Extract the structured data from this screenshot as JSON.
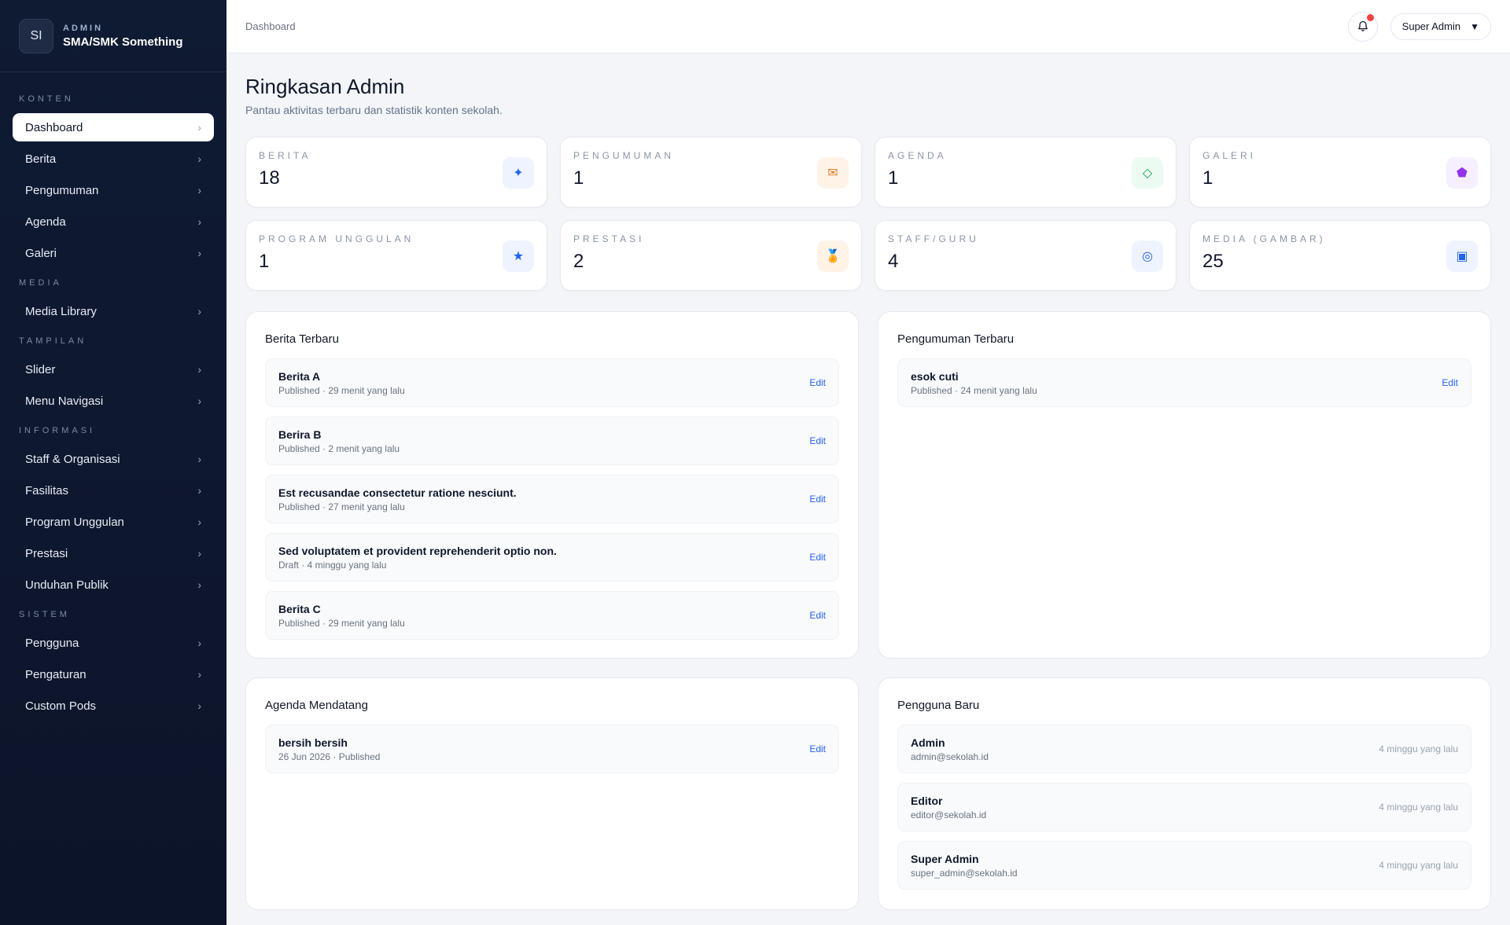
{
  "brand": {
    "logo": "SI",
    "kicker": "ADMIN",
    "name": "SMA/SMK Something"
  },
  "sidebar": {
    "sections": [
      {
        "title": "KONTEN",
        "items": [
          {
            "label": "Dashboard",
            "active": true
          },
          {
            "label": "Berita"
          },
          {
            "label": "Pengumuman"
          },
          {
            "label": "Agenda"
          },
          {
            "label": "Galeri"
          }
        ]
      },
      {
        "title": "MEDIA",
        "items": [
          {
            "label": "Media Library"
          }
        ]
      },
      {
        "title": "TAMPILAN",
        "items": [
          {
            "label": "Slider"
          },
          {
            "label": "Menu Navigasi"
          }
        ]
      },
      {
        "title": "INFORMASI",
        "items": [
          {
            "label": "Staff & Organisasi"
          },
          {
            "label": "Fasilitas"
          },
          {
            "label": "Program Unggulan"
          },
          {
            "label": "Prestasi"
          },
          {
            "label": "Unduhan Publik"
          }
        ]
      },
      {
        "title": "SISTEM",
        "items": [
          {
            "label": "Pengguna"
          },
          {
            "label": "Pengaturan"
          },
          {
            "label": "Custom Pods"
          }
        ]
      }
    ],
    "chevron": "›"
  },
  "header": {
    "breadcrumb": "Dashboard",
    "bell_icon": "bell-icon",
    "user_label": "Super Admin",
    "caret": "▼"
  },
  "page": {
    "title": "Ringkasan Admin",
    "subtitle": "Pantau aktivitas terbaru dan statistik konten sekolah."
  },
  "stats": [
    {
      "label": "BERITA",
      "value": "18",
      "icon": "✦",
      "icon_name": "sparkle-icon",
      "color": "#2563eb",
      "bg": "#eef3ff"
    },
    {
      "label": "PENGUMUMAN",
      "value": "1",
      "icon": "✉",
      "icon_name": "mail-icon",
      "color": "#ea7a2a",
      "bg": "#fff3e8"
    },
    {
      "label": "AGENDA",
      "value": "1",
      "icon": "◇",
      "icon_name": "diamond-icon",
      "color": "#16a34a",
      "bg": "#ecfbf1"
    },
    {
      "label": "GALERI",
      "value": "1",
      "icon": "⬟",
      "icon_name": "pentagon-icon",
      "color": "#9333ea",
      "bg": "#f6efff"
    },
    {
      "label": "PROGRAM UNGGULAN",
      "value": "1",
      "icon": "★",
      "icon_name": "star-icon",
      "color": "#2563eb",
      "bg": "#eef3ff"
    },
    {
      "label": "PRESTASI",
      "value": "2",
      "icon": "🏅",
      "icon_name": "medal-icon",
      "color": "#c2410c",
      "bg": "#fff3e8"
    },
    {
      "label": "STAFF/GURU",
      "value": "4",
      "icon": "◎",
      "icon_name": "target-icon",
      "color": "#2563eb",
      "bg": "#eef3ff"
    },
    {
      "label": "MEDIA (GAMBAR)",
      "value": "25",
      "icon": "▣",
      "icon_name": "image-icon",
      "color": "#2563eb",
      "bg": "#eef3ff"
    }
  ],
  "panels": {
    "berita": {
      "title": "Berita Terbaru",
      "edit_label": "Edit",
      "items": [
        {
          "title": "Berita A",
          "meta": "Published · 29 menit yang lalu"
        },
        {
          "title": "Berira B",
          "meta": "Published · 2 menit yang lalu"
        },
        {
          "title": "Est recusandae consectetur ratione nesciunt.",
          "meta": "Published · 27 menit yang lalu"
        },
        {
          "title": "Sed voluptatem et provident reprehenderit optio non.",
          "meta": "Draft · 4 minggu yang lalu"
        },
        {
          "title": "Berita C",
          "meta": "Published · 29 menit yang lalu"
        }
      ]
    },
    "pengumuman": {
      "title": "Pengumuman Terbaru",
      "edit_label": "Edit",
      "items": [
        {
          "title": "esok cuti",
          "meta": "Published · 24 menit yang lalu"
        }
      ]
    },
    "agenda": {
      "title": "Agenda Mendatang",
      "edit_label": "Edit",
      "items": [
        {
          "title": "bersih bersih",
          "meta": "26 Jun 2026 · Published"
        }
      ]
    },
    "pengguna": {
      "title": "Pengguna Baru",
      "items": [
        {
          "title": "Admin",
          "meta": "admin@sekolah.id",
          "time": "4 minggu yang lalu"
        },
        {
          "title": "Editor",
          "meta": "editor@sekolah.id",
          "time": "4 minggu yang lalu"
        },
        {
          "title": "Super Admin",
          "meta": "super_admin@sekolah.id",
          "time": "4 minggu yang lalu"
        }
      ]
    }
  }
}
